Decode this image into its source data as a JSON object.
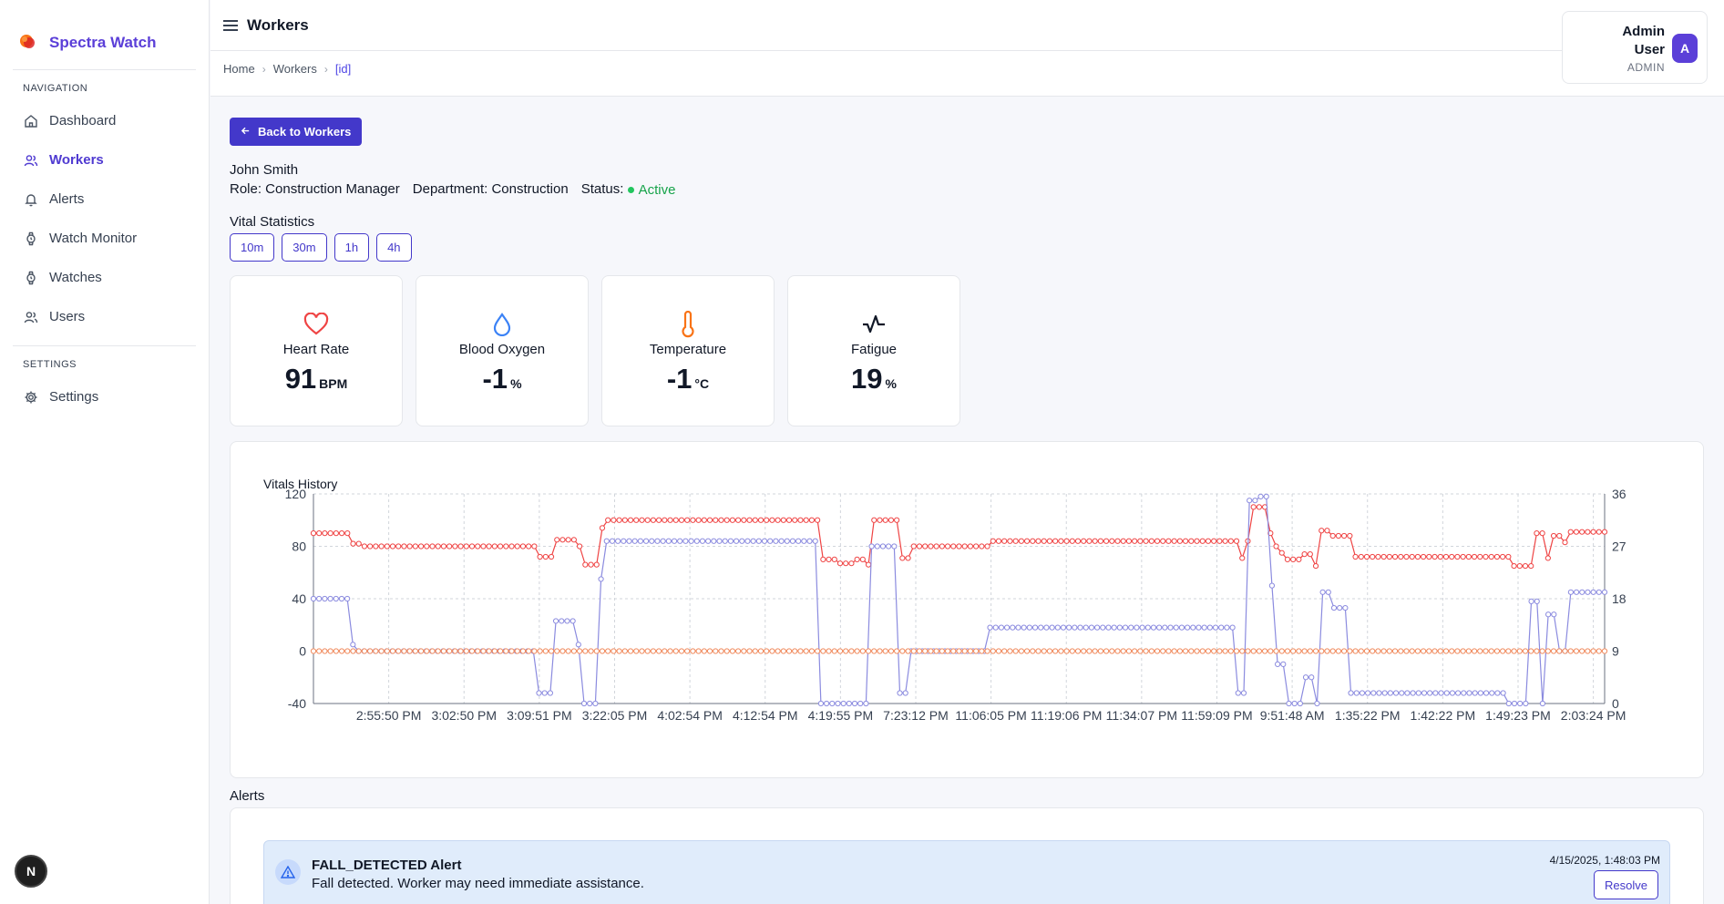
{
  "app": {
    "name": "Spectra Watch"
  },
  "sidebar": {
    "nav_label": "NAVIGATION",
    "items": [
      {
        "label": "Dashboard",
        "icon": "home-icon",
        "active": false
      },
      {
        "label": "Workers",
        "icon": "users-icon",
        "active": true
      },
      {
        "label": "Alerts",
        "icon": "bell-icon",
        "active": false
      },
      {
        "label": "Watch Monitor",
        "icon": "watch-icon",
        "active": false
      },
      {
        "label": "Watches",
        "icon": "watch-icon",
        "active": false
      },
      {
        "label": "Users",
        "icon": "users-icon",
        "active": false
      }
    ],
    "settings_label": "SETTINGS",
    "settings_item": "Settings",
    "n_badge": "N"
  },
  "header": {
    "title": "Workers",
    "breadcrumb": [
      "Home",
      "Workers",
      "[id]"
    ],
    "user": {
      "name": "Admin User",
      "role": "ADMIN",
      "initial": "A"
    }
  },
  "worker": {
    "back_label": "Back to Workers",
    "name": "John Smith",
    "role": "Role: Construction Manager",
    "department": "Department: Construction",
    "status_label": "Status:",
    "status": "Active"
  },
  "vitals": {
    "title": "Vital Statistics",
    "ranges": [
      "10m",
      "30m",
      "1h",
      "4h"
    ],
    "cards": [
      {
        "label": "Heart Rate",
        "value": "91",
        "unit": "BPM",
        "icon": "heart-icon",
        "color": "#ef4444"
      },
      {
        "label": "Blood Oxygen",
        "value": "-1",
        "unit": "%",
        "icon": "droplet-icon",
        "color": "#3b82f6"
      },
      {
        "label": "Temperature",
        "value": "-1",
        "unit": "°C",
        "icon": "thermometer-icon",
        "color": "#f97316"
      },
      {
        "label": "Fatigue",
        "value": "19",
        "unit": "%",
        "icon": "activity-icon",
        "color": "#111827"
      }
    ]
  },
  "chart_data": {
    "type": "line",
    "title": "Vitals History",
    "x_tick_labels": [
      "2:55:50 PM",
      "3:02:50 PM",
      "3:09:51 PM",
      "3:22:05 PM",
      "4:02:54 PM",
      "4:12:54 PM",
      "4:19:55 PM",
      "7:23:12 PM",
      "11:06:05 PM",
      "11:19:06 PM",
      "11:34:07 PM",
      "11:59:09 PM",
      "9:51:48 AM",
      "1:35:22 PM",
      "1:42:22 PM",
      "1:49:23 PM",
      "2:03:24 PM"
    ],
    "ylim_left": [
      -40,
      120
    ],
    "yticks_left": [
      -40,
      0,
      40,
      80,
      120
    ],
    "ylim_right": [
      0,
      36
    ],
    "yticks_right": [
      0,
      9,
      18,
      27,
      36
    ],
    "grid": true,
    "colors": {
      "heart_rate": "#ef4444",
      "blood_oxygen": "#8b8bdf",
      "temperature": "#f08a5d"
    },
    "series": [
      {
        "key": "heart_rate",
        "axis": "left",
        "values": [
          90,
          90,
          90,
          90,
          90,
          90,
          90,
          82,
          82,
          80,
          80,
          80,
          80,
          80,
          80,
          80,
          80,
          80,
          80,
          80,
          80,
          80,
          80,
          80,
          80,
          80,
          80,
          80,
          80,
          80,
          80,
          80,
          80,
          80,
          80,
          80,
          80,
          80,
          80,
          80,
          72,
          72,
          72,
          85,
          85,
          85,
          85,
          80,
          66,
          66,
          66,
          94,
          100,
          100,
          100,
          100,
          100,
          100,
          100,
          100,
          100,
          100,
          100,
          100,
          100,
          100,
          100,
          100,
          100,
          100,
          100,
          100,
          100,
          100,
          100,
          100,
          100,
          100,
          100,
          100,
          100,
          100,
          100,
          100,
          100,
          100,
          100,
          100,
          100,
          100,
          70,
          70,
          70,
          67,
          67,
          67,
          70,
          70,
          66,
          100,
          100,
          100,
          100,
          100,
          71,
          71,
          80,
          80,
          80,
          80,
          80,
          80,
          80,
          80,
          80,
          80,
          80,
          80,
          80,
          80,
          84,
          84,
          84,
          84,
          84,
          84,
          84,
          84,
          84,
          84,
          84,
          84,
          84,
          84,
          84,
          84,
          84,
          84,
          84,
          84,
          84,
          84,
          84,
          84,
          84,
          84,
          84,
          84,
          84,
          84,
          84,
          84,
          84,
          84,
          84,
          84,
          84,
          84,
          84,
          84,
          84,
          84,
          84,
          84,
          71,
          84,
          110,
          110,
          110,
          90,
          80,
          75,
          70,
          70,
          70,
          74,
          74,
          65,
          92,
          92,
          88,
          88,
          88,
          88,
          72,
          72,
          72,
          72,
          72,
          72,
          72,
          72,
          72,
          72,
          72,
          72,
          72,
          72,
          72,
          72,
          72,
          72,
          72,
          72,
          72,
          72,
          72,
          72,
          72,
          72,
          72,
          72,
          65,
          65,
          65,
          65,
          90,
          90,
          71,
          88,
          88,
          83,
          91,
          91,
          91,
          91,
          91,
          91,
          91
        ]
      },
      {
        "key": "blood_oxygen",
        "axis": "left",
        "values": [
          40,
          40,
          40,
          40,
          40,
          40,
          40,
          5,
          0,
          0,
          0,
          0,
          0,
          0,
          0,
          0,
          0,
          0,
          0,
          0,
          0,
          0,
          0,
          0,
          0,
          0,
          0,
          0,
          0,
          0,
          0,
          0,
          0,
          0,
          0,
          0,
          0,
          0,
          0,
          0,
          -32,
          -32,
          -32,
          23,
          23,
          23,
          23,
          5,
          -40,
          -40,
          -40,
          55,
          84,
          84,
          84,
          84,
          84,
          84,
          84,
          84,
          84,
          84,
          84,
          84,
          84,
          84,
          84,
          84,
          84,
          84,
          84,
          84,
          84,
          84,
          84,
          84,
          84,
          84,
          84,
          84,
          84,
          84,
          84,
          84,
          84,
          84,
          84,
          84,
          84,
          84,
          -40,
          -40,
          -40,
          -40,
          -40,
          -40,
          -40,
          -40,
          -40,
          80,
          80,
          80,
          80,
          80,
          -32,
          -32,
          0,
          0,
          0,
          0,
          0,
          0,
          0,
          0,
          0,
          0,
          0,
          0,
          0,
          0,
          18,
          18,
          18,
          18,
          18,
          18,
          18,
          18,
          18,
          18,
          18,
          18,
          18,
          18,
          18,
          18,
          18,
          18,
          18,
          18,
          18,
          18,
          18,
          18,
          18,
          18,
          18,
          18,
          18,
          18,
          18,
          18,
          18,
          18,
          18,
          18,
          18,
          18,
          18,
          18,
          18,
          18,
          18,
          18,
          -32,
          -32,
          115,
          115,
          118,
          118,
          50,
          -10,
          -10,
          -40,
          -40,
          -40,
          -20,
          -20,
          -40,
          45,
          45,
          33,
          33,
          33,
          -32,
          -32,
          -32,
          -32,
          -32,
          -32,
          -32,
          -32,
          -32,
          -32,
          -32,
          -32,
          -32,
          -32,
          -32,
          -32,
          -32,
          -32,
          -32,
          -32,
          -32,
          -32,
          -32,
          -32,
          -32,
          -32,
          -32,
          -32,
          -40,
          -40,
          -40,
          -40,
          38,
          38,
          -40,
          28,
          28,
          0,
          0,
          45,
          45,
          45,
          45,
          45,
          45,
          45
        ]
      },
      {
        "key": "temperature",
        "axis": "left",
        "constant": 0
      }
    ]
  },
  "alerts": {
    "label": "Alerts",
    "items": [
      {
        "title": "FALL_DETECTED Alert",
        "message": "Fall detected. Worker may need immediate assistance.",
        "time": "4/15/2025, 1:48:03 PM",
        "action": "Resolve"
      }
    ]
  }
}
